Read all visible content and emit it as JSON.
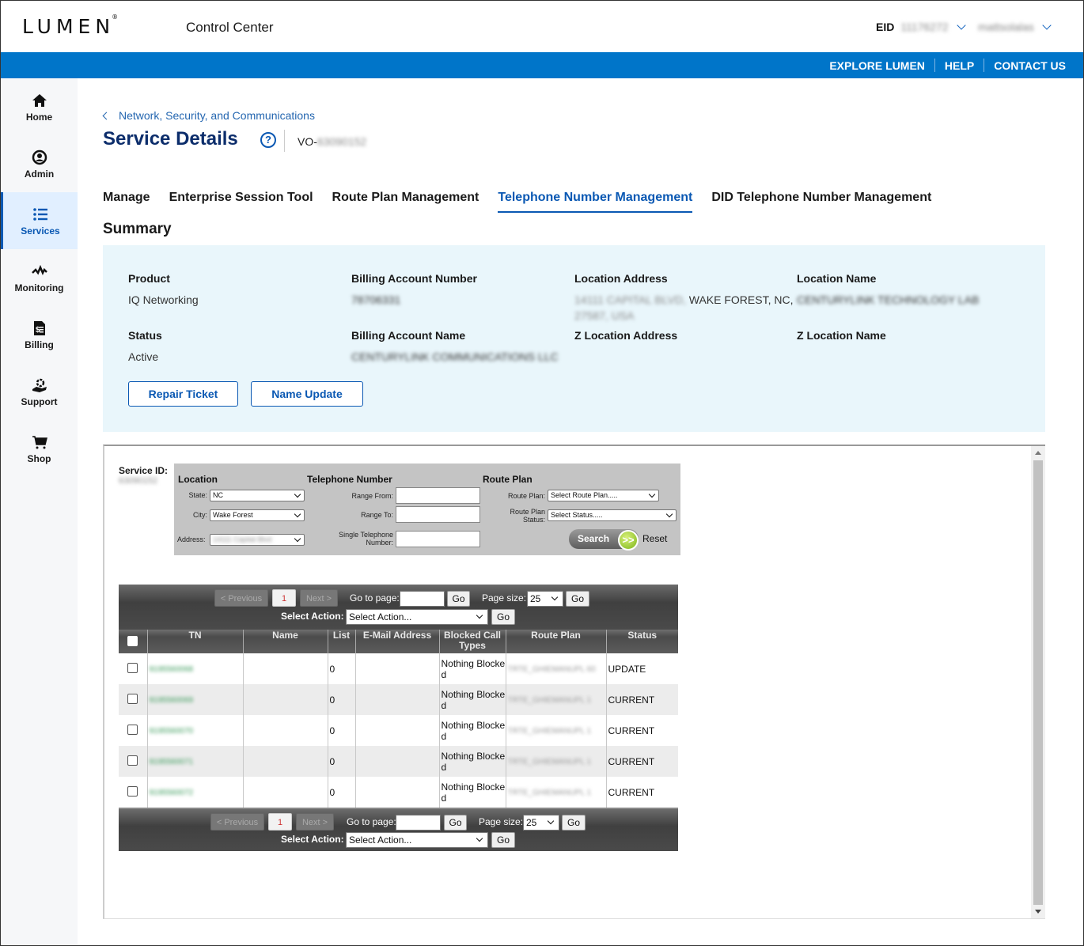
{
  "header": {
    "logo": "LUMEN",
    "app_title": "Control Center",
    "eid_label": "EID",
    "eid_value": "11176272",
    "user_name": "mattsolalas"
  },
  "utility_nav": [
    "EXPLORE LUMEN",
    "HELP",
    "CONTACT US"
  ],
  "sidebar": {
    "items": [
      {
        "label": "Home",
        "icon": "home-icon"
      },
      {
        "label": "Admin",
        "icon": "user-circle-icon"
      },
      {
        "label": "Services",
        "icon": "list-icon",
        "active": true
      },
      {
        "label": "Monitoring",
        "icon": "pulse-icon"
      },
      {
        "label": "Billing",
        "icon": "invoice-icon"
      },
      {
        "label": "Support",
        "icon": "support-icon"
      },
      {
        "label": "Shop",
        "icon": "cart-icon"
      }
    ]
  },
  "breadcrumb": "Network, Security, and Communications",
  "page_title": "Service Details",
  "service_id_prefix": "VO-",
  "service_id_value": "63090152",
  "tabs": [
    {
      "label": "Manage"
    },
    {
      "label": "Enterprise Session Tool"
    },
    {
      "label": "Route Plan Management"
    },
    {
      "label": "Telephone Number Management",
      "active": true
    },
    {
      "label": "DID Telephone Number Management"
    }
  ],
  "summary": {
    "title": "Summary",
    "product_label": "Product",
    "product_value": "IQ Networking",
    "status_label": "Status",
    "status_value": "Active",
    "ban_label": "Billing Account Number",
    "ban_value": "78706331",
    "ban_name_label": "Billing Account Name",
    "ban_name_value": "CENTURYLINK COMMUNICATIONS LLC",
    "loc_addr_label": "Location Address",
    "loc_addr_blurred": "14111 CAPITAL BLVD,",
    "loc_addr_visible": "WAKE FOREST, NC,",
    "loc_addr_line2": "27587, USA",
    "loc_name_label": "Location Name",
    "loc_name_value": "CENTURYLINK TECHNOLOGY LAB",
    "z_addr_label": "Z Location Address",
    "z_name_label": "Z Location Name",
    "repair_ticket": "Repair Ticket",
    "name_update": "Name Update"
  },
  "tn_tool": {
    "service_id_label": "Service ID:",
    "service_id_value": "63090152",
    "filter": {
      "location_heading": "Location",
      "state_label": "State:",
      "state_value": "NC",
      "city_label": "City:",
      "city_value": "Wake Forest",
      "address_label": "Address:",
      "address_value": "14111 Capital Blvd",
      "tn_heading": "Telephone Number",
      "range_from_label": "Range From:",
      "range_to_label": "Range To:",
      "single_tn_label_1": "Single Telephone",
      "single_tn_label_2": "Number:",
      "range_from_value": "",
      "range_to_value": "",
      "single_tn_value": "",
      "route_plan_heading": "Route Plan",
      "route_plan_label": "Route Plan:",
      "route_plan_value": "Select Route Plan.....",
      "rp_status_label_1": "Route Plan",
      "rp_status_label_2": "Status:",
      "rp_status_value": "Select Status.....",
      "search": "Search",
      "go_glyph": ">>",
      "reset": "Reset"
    },
    "pager": {
      "previous": "< Previous",
      "page": "1",
      "next": "Next >",
      "goto_label": "Go to page:",
      "go": "Go",
      "page_size_label": "Page size:",
      "page_size": "25",
      "select_action_label": "Select Action:",
      "select_action_value": "Select Action..."
    },
    "columns": [
      "TN",
      "Name",
      "List",
      "E-Mail Address",
      "Blocked Call Types",
      "Route Plan",
      "Status"
    ],
    "rows": [
      {
        "tn": "9195560068",
        "name": "",
        "list": "0",
        "email": "",
        "blocked": "Nothing Blocked",
        "route_plan": "TRTE_GHIEMANUPL 60",
        "status": "UPDATE"
      },
      {
        "tn": "9195560069",
        "name": "",
        "list": "0",
        "email": "",
        "blocked": "Nothing Blocked",
        "route_plan": "TRTE_GHIEMANUPL 1",
        "status": "CURRENT"
      },
      {
        "tn": "9195560070",
        "name": "",
        "list": "0",
        "email": "",
        "blocked": "Nothing Blocked",
        "route_plan": "TRTE_GHIEMANUPL 1",
        "status": "CURRENT"
      },
      {
        "tn": "9195560071",
        "name": "",
        "list": "0",
        "email": "",
        "blocked": "Nothing Blocked",
        "route_plan": "TRTE_GHIEMANUPL 1",
        "status": "CURRENT"
      },
      {
        "tn": "9195560072",
        "name": "",
        "list": "0",
        "email": "",
        "blocked": "Nothing Blocked",
        "route_plan": "TRTE_GHIEMANUPL 1",
        "status": "CURRENT"
      }
    ]
  }
}
